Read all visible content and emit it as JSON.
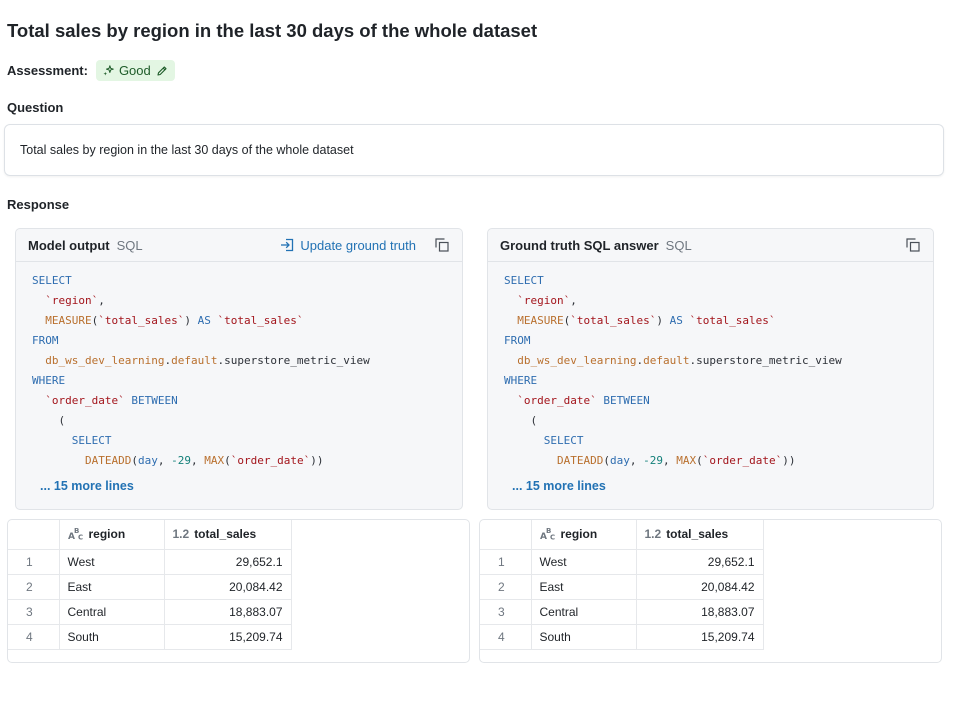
{
  "page": {
    "title": "Total sales by region in the last 30 days of the whole dataset",
    "assessment_label": "Assessment:",
    "assessment_value": "Good",
    "question_label": "Question",
    "question_text": "Total sales by region in the last 30 days of the whole dataset",
    "response_label": "Response"
  },
  "model_output": {
    "title": "Model output",
    "lang": "SQL",
    "update_label": "Update ground truth",
    "more_lines": "... 15 more lines"
  },
  "ground_truth": {
    "title": "Ground truth SQL answer",
    "lang": "SQL",
    "more_lines": "... 15 more lines"
  },
  "sql_tokens": {
    "select": "SELECT",
    "region": "`region`",
    "comma": ",",
    "measure_fn": "MEASURE",
    "measure_open": "(",
    "total_sales_col": "`total_sales`",
    "measure_close": ")",
    "as": "AS",
    "total_sales_alias": "`total_sales`",
    "from": "FROM",
    "catalog": "db_ws_dev_learning",
    "dot1": ".",
    "schema": "default",
    "table": ".superstore_metric_view",
    "where": "WHERE",
    "order_date": "`order_date`",
    "between": "BETWEEN",
    "paren": "(",
    "inner_select": "SELECT",
    "dateadd": "DATEADD",
    "dateadd_open": "(",
    "day": "day",
    "sep1": ", ",
    "neg29": "-29",
    "sep2": ", ",
    "max": "MAX",
    "max_open": "(",
    "order_date_inner": "`order_date`",
    "close": "))"
  },
  "table": {
    "col_region": "region",
    "col_sales_type": "1.2",
    "col_sales": "total_sales",
    "rows": [
      {
        "idx": "1",
        "region": "West",
        "sales": "29,652.1"
      },
      {
        "idx": "2",
        "region": "East",
        "sales": "20,084.42"
      },
      {
        "idx": "3",
        "region": "Central",
        "sales": "18,883.07"
      },
      {
        "idx": "4",
        "region": "South",
        "sales": "15,209.74"
      }
    ]
  },
  "icons": {
    "sparkle": "sparkle-icon",
    "pencil": "pencil-icon",
    "update": "import-arrow-icon",
    "copy": "copy-icon",
    "string_type": "abc-type-icon"
  },
  "colors": {
    "link": "#2272b4",
    "keyword": "#2e6db0",
    "string": "#a3151c",
    "function": "#b9702e",
    "badge_bg": "#e3f6e3"
  }
}
